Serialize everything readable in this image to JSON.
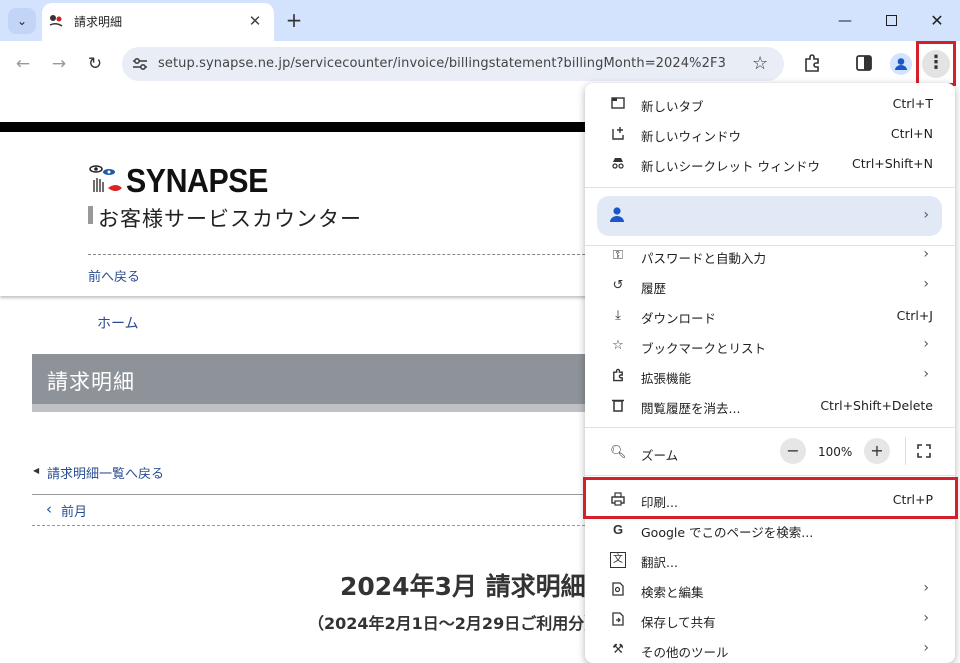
{
  "browser": {
    "tab_title": "請求明細",
    "url": "setup.synapse.ne.jp/servicecounter/invoice/billingstatement?billingMonth=2024%2F3",
    "icons": [
      "tab-list-icon",
      "close-icon",
      "plus-icon",
      "minimize-icon",
      "maximize-icon",
      "back-icon",
      "forward-icon",
      "reload-icon",
      "site-info-icon",
      "star-icon",
      "puzzle-icon",
      "sidepanel-icon",
      "profile-icon",
      "more-vert-icon"
    ]
  },
  "page": {
    "logo_text": "SYNAPSE",
    "subtitle": "お客様サービスカウンター",
    "back_link": "前へ戻る",
    "home_link": "ホーム",
    "title": "請求明細",
    "list_link": "請求明細一覧へ戻る",
    "prev_link": "前月",
    "invoice_heading": "2024年3月 請求明細",
    "invoice_period": "（2024年2月1日〜2月29日ご利用分）"
  },
  "menu": {
    "items": [
      {
        "label": "新しいタブ",
        "shortcut": "Ctrl+T"
      },
      {
        "label": "新しいウィンドウ",
        "shortcut": "Ctrl+N"
      },
      {
        "label": "新しいシークレット ウィンドウ",
        "shortcut": "Ctrl+Shift+N"
      },
      {
        "label": "パスワードと自動入力"
      },
      {
        "label": "履歴"
      },
      {
        "label": "ダウンロード",
        "shortcut": "Ctrl+J"
      },
      {
        "label": "ブックマークとリスト"
      },
      {
        "label": "拡張機能"
      },
      {
        "label": "閲覧履歴を消去...",
        "shortcut": "Ctrl+Shift+Delete"
      },
      {
        "label": "ズーム"
      },
      {
        "label": "印刷...",
        "shortcut": "Ctrl+P"
      },
      {
        "label": "Google でこのページを検索..."
      },
      {
        "label": "翻訳..."
      },
      {
        "label": "検索と編集"
      },
      {
        "label": "保存して共有"
      },
      {
        "label": "その他のツール"
      }
    ],
    "zoom": {
      "minus": "−",
      "value": "100%",
      "plus": "+"
    }
  },
  "colors": {
    "highlight": "#d3202a",
    "tabstrip": "#d3e3fd",
    "link": "#2a4d8f"
  }
}
